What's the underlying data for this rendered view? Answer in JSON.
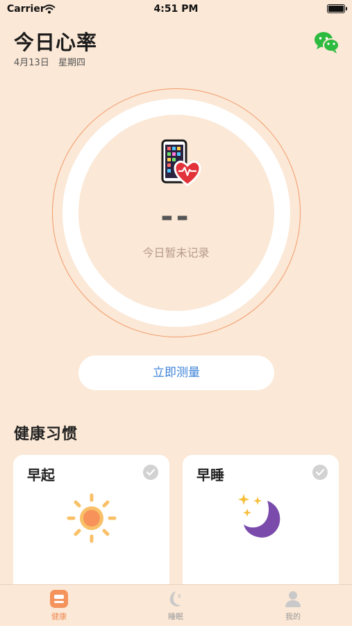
{
  "status_bar": {
    "carrier": "Carrier",
    "time": "4:51 PM"
  },
  "header": {
    "title": "今日心率",
    "date": "4月13日",
    "weekday": "星期四"
  },
  "heart_rate": {
    "value": "--",
    "status": "今日暂未记录"
  },
  "measure_button": {
    "label": "立即测量"
  },
  "habits": {
    "title": "健康习惯",
    "cards": [
      {
        "label": "早起",
        "icon": "sun-icon"
      },
      {
        "label": "早睡",
        "icon": "moon-stars-icon"
      }
    ]
  },
  "tabs": [
    {
      "label": "健康",
      "icon": "health-icon",
      "active": true
    },
    {
      "label": "睡眠",
      "icon": "sleep-icon",
      "active": false
    },
    {
      "label": "我的",
      "icon": "profile-icon",
      "active": false
    }
  ],
  "colors": {
    "background": "#fbe8d6",
    "accent": "#f08a52",
    "link": "#3d82d8",
    "wechat": "#2dbb3f",
    "moon": "#7a4bab",
    "heart": "#e2323a"
  }
}
